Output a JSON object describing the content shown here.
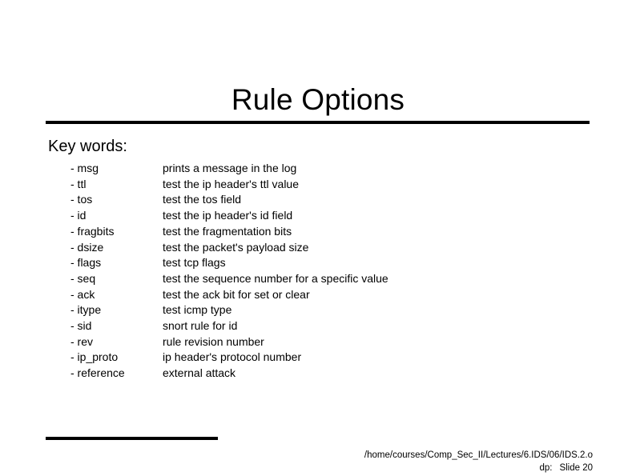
{
  "slide": {
    "title": "Rule Options",
    "section_heading": "Key words:",
    "keywords": [
      {
        "key": "- msg",
        "desc": "prints a message in the log"
      },
      {
        "key": "- ttl",
        "desc": "test the ip header's ttl value"
      },
      {
        "key": "- tos",
        "desc": "test the tos field"
      },
      {
        "key": "- id",
        "desc": "test the ip header's id field"
      },
      {
        "key": "- fragbits",
        "desc": "test the fragmentation bits"
      },
      {
        "key": "- dsize",
        "desc": "test the packet's payload size"
      },
      {
        "key": "- flags",
        "desc": "test tcp flags"
      },
      {
        "key": "- seq",
        "desc": "test the sequence number for a specific value"
      },
      {
        "key": "- ack",
        "desc": "test the ack bit for set or clear"
      },
      {
        "key": "- itype",
        "desc": "test icmp type"
      },
      {
        "key": "- sid",
        "desc": "snort rule for id"
      },
      {
        "key": "- rev",
        "desc": "rule revision number"
      },
      {
        "key": "- ip_proto",
        "desc": "ip header's protocol number"
      },
      {
        "key": "- reference",
        "desc": "external attack"
      }
    ],
    "footer": {
      "path": "/home/courses/Comp_Sec_II/Lectures/6.IDS/06/IDS.2.o",
      "author": "dp:",
      "slide_label": "Slide 20"
    },
    "colors": {
      "background": "#ffffff",
      "text": "#000000",
      "rule": "#000000"
    }
  }
}
